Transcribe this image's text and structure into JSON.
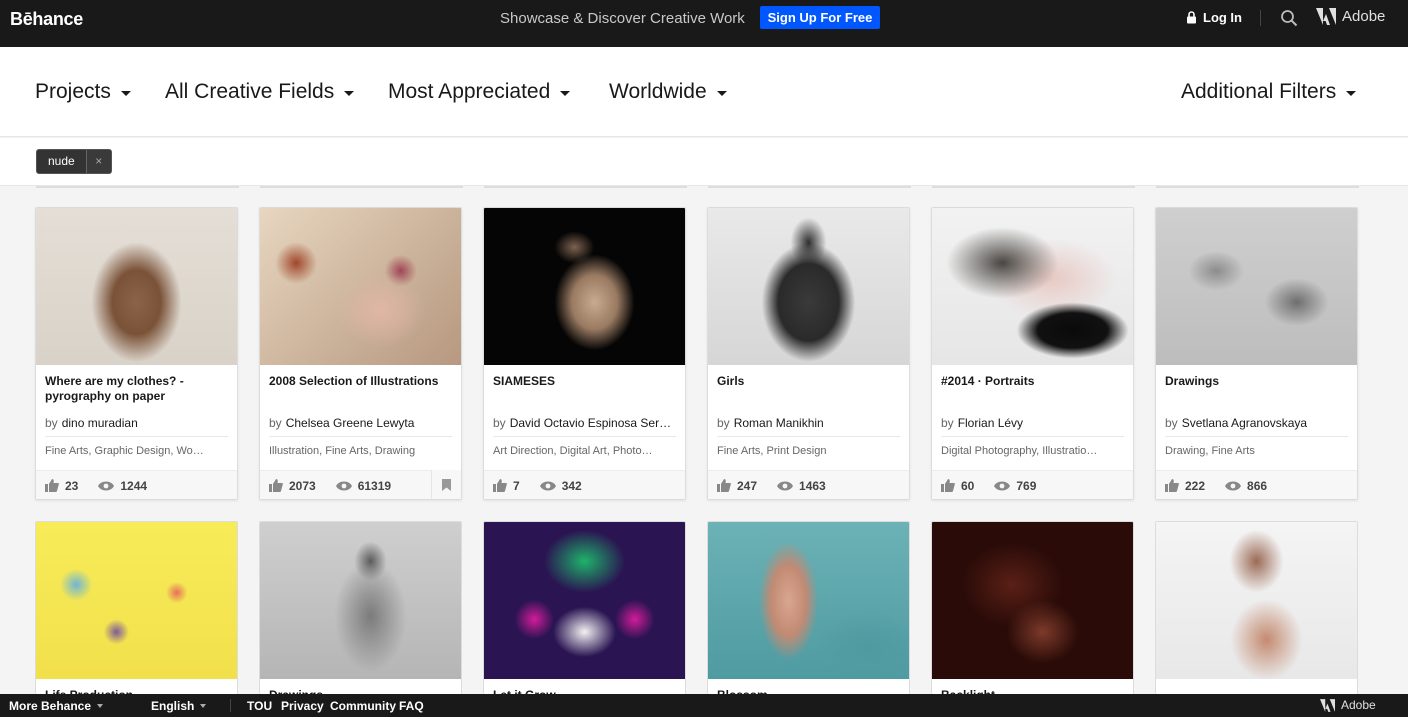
{
  "header": {
    "logo": "Bēhance",
    "tagline": "Showcase & Discover Creative Work",
    "signup_label": "Sign Up For Free",
    "login_label": "Log In",
    "adobe_label": "Adobe"
  },
  "filters": {
    "items": [
      "Projects",
      "All Creative Fields",
      "Most Appreciated",
      "Worldwide"
    ],
    "additional": "Additional Filters"
  },
  "tags": {
    "active": "nude",
    "remove_symbol": "×"
  },
  "projects_row1": [
    {
      "title": "Where are my clothes? - pyrography on paper",
      "owner": "dino muradian",
      "fields": "Fine Arts, Graphic Design, Wo…",
      "appreciations": "23",
      "views": "1244"
    },
    {
      "title": "2008 Selection of Illustrations",
      "owner": "Chelsea Greene Lewyta",
      "fields": "Illustration, Fine Arts, Drawing",
      "appreciations": "2073",
      "views": "61319"
    },
    {
      "title": "SIAMESES",
      "owner": "David Octavio Espinosa Ser…",
      "fields": "Art Direction, Digital Art, Photo…",
      "appreciations": "7",
      "views": "342"
    },
    {
      "title": "Girls",
      "owner": "Roman Manikhin",
      "fields": "Fine Arts, Print Design",
      "appreciations": "247",
      "views": "1463"
    },
    {
      "title": "#2014 · Portraits",
      "owner": "Florian Lévy",
      "fields": "Digital Photography, Illustratio…",
      "appreciations": "60",
      "views": "769"
    },
    {
      "title": "Drawings",
      "owner": "Svetlana Agranovskaya",
      "fields": "Drawing, Fine Arts",
      "appreciations": "222",
      "views": "866"
    }
  ],
  "projects_row2": [
    {
      "title": "Life Production"
    },
    {
      "title": "Drawings"
    },
    {
      "title": "Let it Grow"
    },
    {
      "title": "Blossom"
    },
    {
      "title": "Backlight"
    },
    {
      "title": ""
    }
  ],
  "labels": {
    "by": "by"
  },
  "footer": {
    "more": "More Behance",
    "language": "English",
    "links": [
      "TOU",
      "Privacy",
      "Community",
      "FAQ"
    ],
    "adobe": "Adobe"
  }
}
